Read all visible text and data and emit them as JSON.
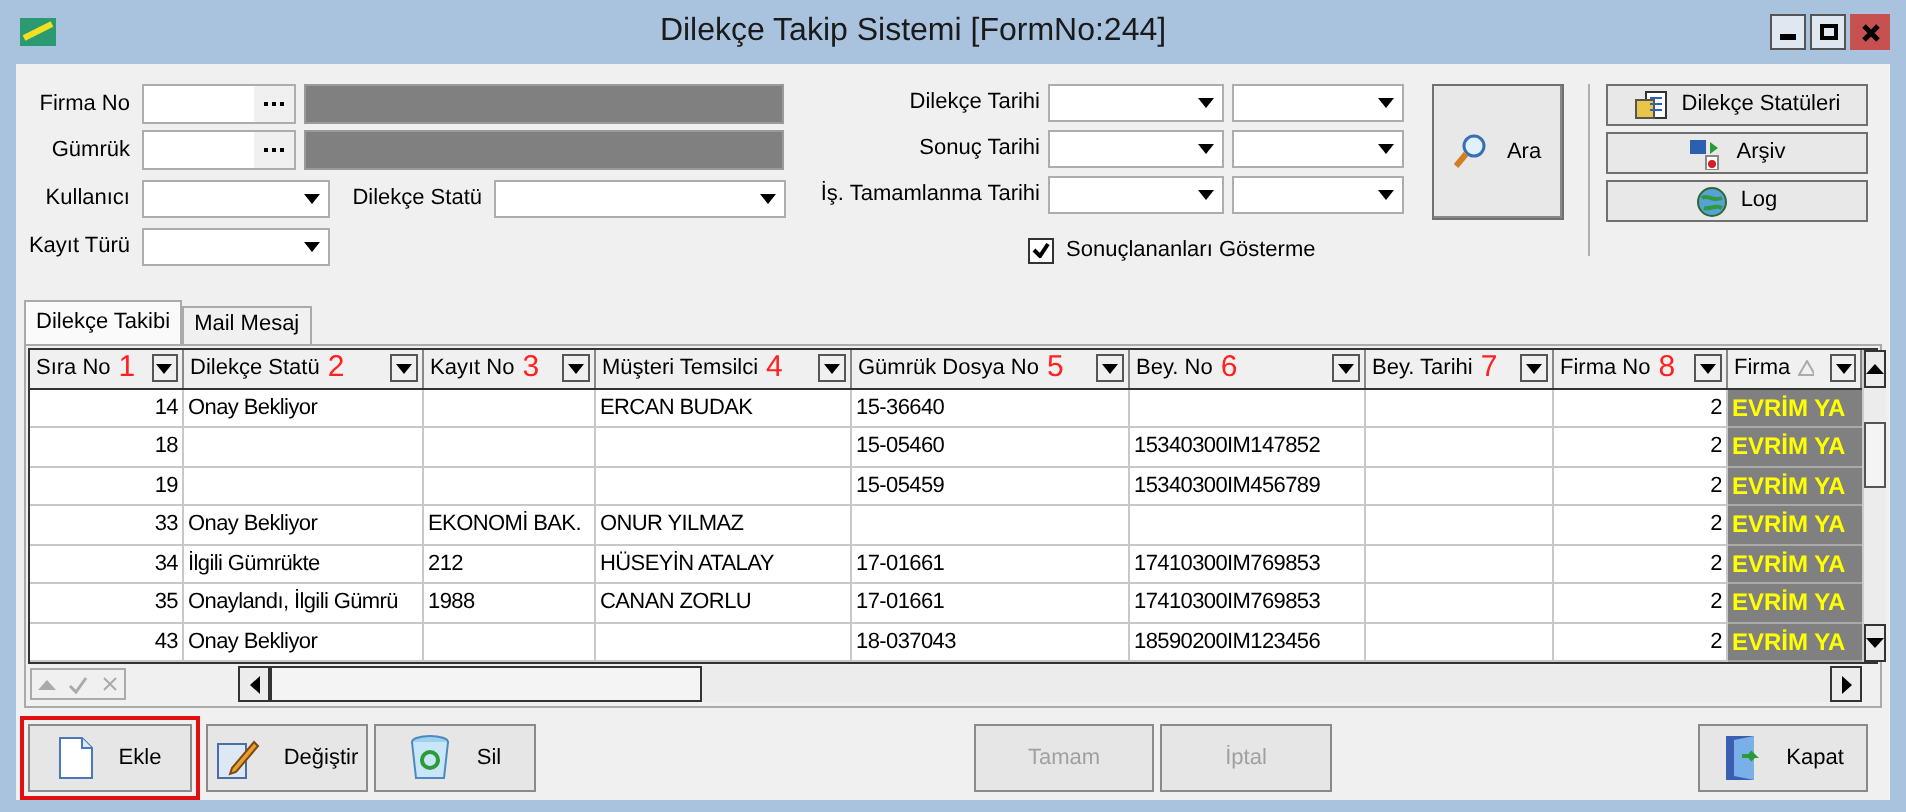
{
  "window": {
    "title": "Dilekçe Takip Sistemi [FormNo:244]"
  },
  "filters": {
    "firma_no": {
      "label": "Firma No"
    },
    "gumruk": {
      "label": "Gümrük"
    },
    "kullanici": {
      "label": "Kullanıcı"
    },
    "dilekce_statu": {
      "label": "Dilekçe Statü"
    },
    "kayit_turu": {
      "label": "Kayıt Türü"
    },
    "date_ranges": [
      {
        "label": "Dilekçe Tarihi"
      },
      {
        "label": "Sonuç Tarihi"
      },
      {
        "label": "İş. Tamamlanma Tarihi"
      }
    ],
    "hide_completed": {
      "label": "Sonuçlananları Gösterme",
      "checked": true
    },
    "search_button": {
      "label": "Ara"
    }
  },
  "side_buttons": [
    {
      "label": "Dilekçe Statüleri",
      "kind": "statuses"
    },
    {
      "label": "Arşiv",
      "kind": "archive"
    },
    {
      "label": "Log",
      "kind": "log"
    }
  ],
  "tabs": [
    {
      "label": "Dilekçe Takibi",
      "selected": true
    },
    {
      "label": "Mail Mesaj",
      "selected": false
    }
  ],
  "table": {
    "columns": [
      {
        "label": "Sıra No",
        "marker": "1"
      },
      {
        "label": "Dilekçe Statü",
        "marker": "2"
      },
      {
        "label": "Kayıt No",
        "marker": "3"
      },
      {
        "label": "Müşteri Temsilci",
        "marker": "4"
      },
      {
        "label": "Gümrük Dosya No",
        "marker": "5"
      },
      {
        "label": "Bey. No",
        "marker": "6"
      },
      {
        "label": "Bey. Tarihi",
        "marker": "7"
      },
      {
        "label": "Firma No",
        "marker": "8"
      },
      {
        "label": "Firma",
        "sorted": true
      }
    ],
    "rows": [
      [
        "14",
        "Onay Bekliyor",
        null,
        "ERCAN  BUDAK",
        "15-36640",
        null,
        null,
        "2",
        "EVRİM YA"
      ],
      [
        "18",
        null,
        null,
        null,
        "15-05460",
        "15340300IM147852",
        null,
        "2",
        "EVRİM YA"
      ],
      [
        "19",
        null,
        null,
        null,
        "15-05459",
        "15340300IM456789",
        null,
        "2",
        "EVRİM YA"
      ],
      [
        "33",
        "Onay Bekliyor",
        "EKONOMİ BAK.",
        "ONUR  YILMAZ",
        null,
        null,
        null,
        "2",
        "EVRİM YA"
      ],
      [
        "34",
        "İlgili Gümrükte",
        "212",
        "HÜSEYİN ATALAY",
        "17-01661",
        "17410300IM769853",
        null,
        "2",
        "EVRİM YA"
      ],
      [
        "35",
        "Onaylandı, İlgili Gümrü",
        "1988",
        "CANAN ZORLU",
        "17-01661",
        "17410300IM769853",
        null,
        "2",
        "EVRİM YA"
      ],
      [
        "43",
        "Onay Bekliyor",
        null,
        null,
        "18-037043",
        "18590200IM123456",
        null,
        "2",
        "EVRİM YA"
      ]
    ]
  },
  "bottom_buttons": [
    {
      "label": "Ekle",
      "kind": "add",
      "disabled": false,
      "highlighted": true
    },
    {
      "label": "Değiştir",
      "kind": "edit",
      "disabled": false,
      "highlighted": false
    },
    {
      "label": "Sil",
      "kind": "delete",
      "disabled": false,
      "highlighted": false
    },
    {
      "label": "Tamam",
      "kind": "ok",
      "disabled": true,
      "highlighted": false
    },
    {
      "label": "İptal",
      "kind": "cancel",
      "disabled": true,
      "highlighted": false
    },
    {
      "label": "Kapat",
      "kind": "close",
      "disabled": false,
      "highlighted": false
    }
  ]
}
